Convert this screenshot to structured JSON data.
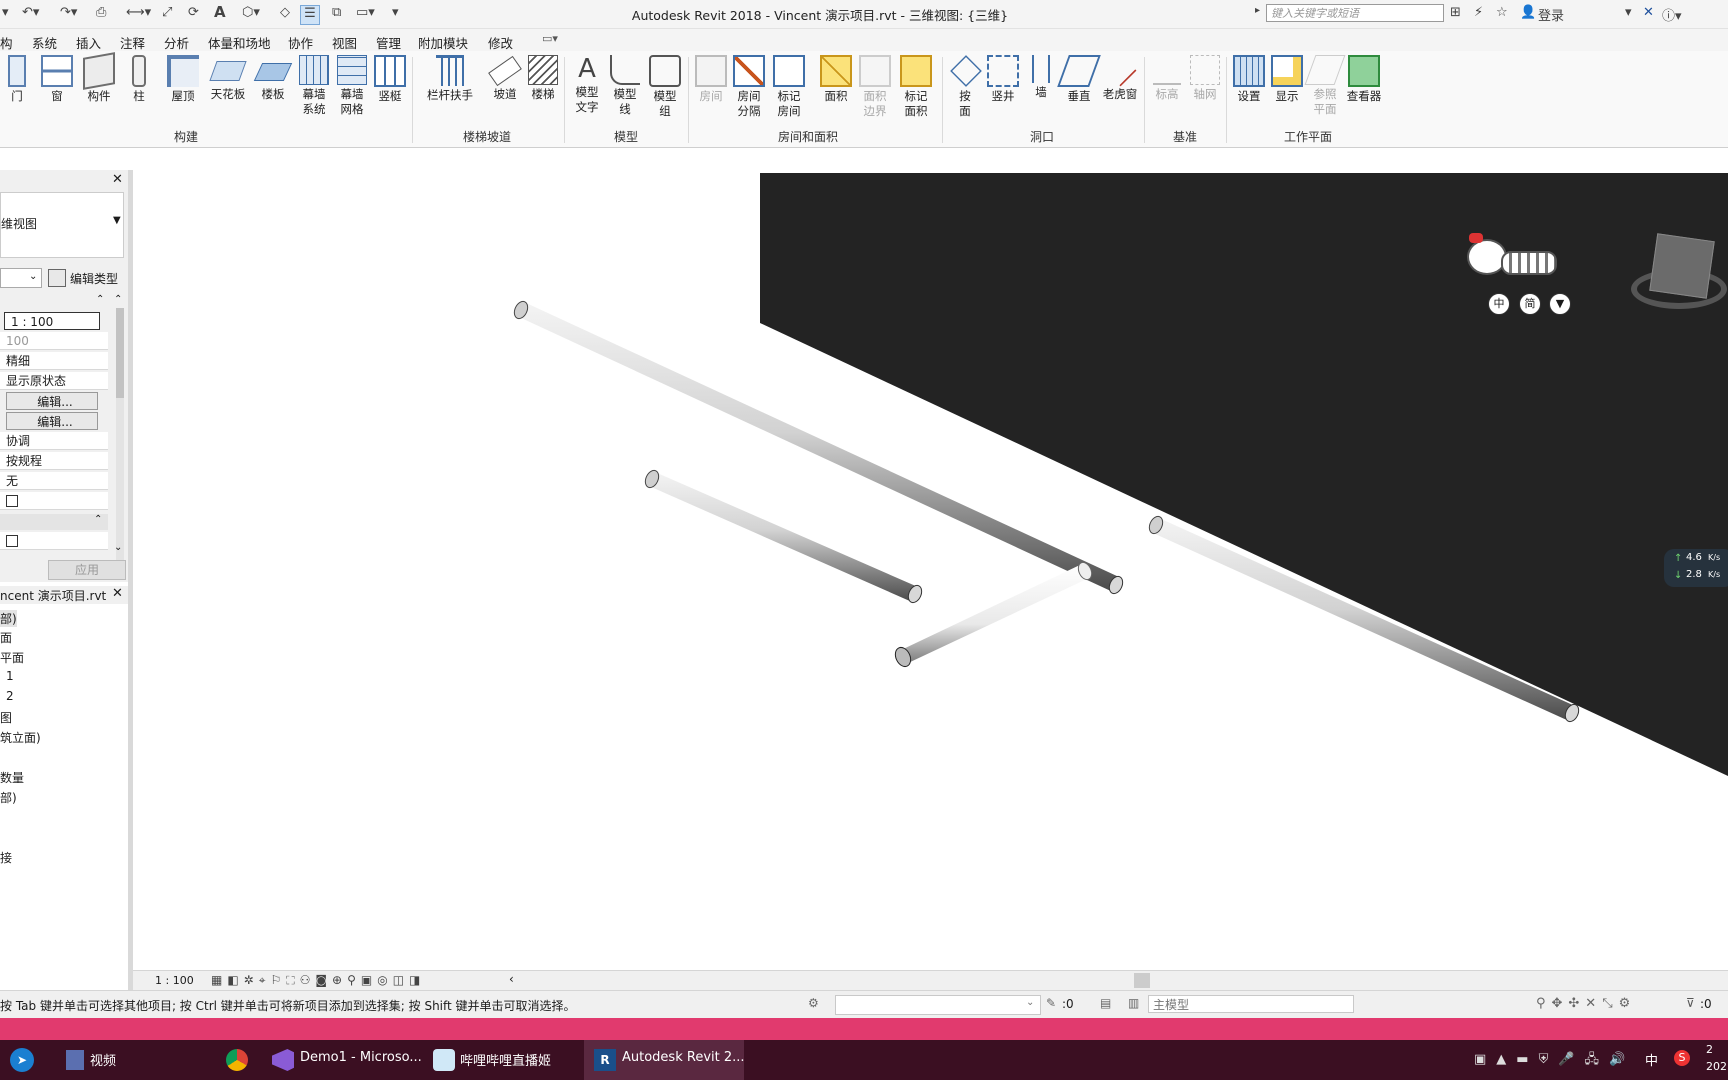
{
  "window": {
    "title": "Autodesk Revit 2018 -     Vincent 演示项目.rvt - 三维视图: {三维}",
    "search_placeholder": "键入关键字或短语",
    "login": "登录"
  },
  "menu_tabs": [
    "构",
    "系统",
    "插入",
    "注释",
    "分析",
    "体量和场地",
    "协作",
    "视图",
    "管理",
    "附加模块",
    "修改"
  ],
  "ribbon": {
    "build": [
      "门",
      "窗",
      "构件",
      "柱",
      "屋顶",
      "天花板",
      "楼板",
      "幕墙\n系统",
      "幕墙\n网格",
      "竖梃"
    ],
    "stairs": [
      "栏杆扶手",
      "坡道",
      "楼梯"
    ],
    "model": [
      "模型\n文字",
      "模型\n线",
      "模型\n组"
    ],
    "room": [
      "房间",
      "房间\n分隔",
      "标记\n房间",
      "面积",
      "面积\n边界",
      "标记\n面积"
    ],
    "opening": [
      "按\n面",
      "竖井",
      "墙",
      "垂直",
      "老虎窗"
    ],
    "datum": [
      "标高",
      "轴网"
    ],
    "workplane": [
      "设置",
      "显示",
      "参照\n平面",
      "查看器"
    ],
    "panels": {
      "build": "构建",
      "stairs": "楼梯坡道",
      "model": "模型",
      "room": "房间和面积",
      "opening": "洞口",
      "datum": "基准",
      "workplane": "工作平面"
    }
  },
  "properties": {
    "type_label": "维视图",
    "edit_type": "编辑类型",
    "rows": [
      "1 : 100",
      "100",
      "精细",
      "显示原状态",
      "编辑...",
      "编辑...",
      "协调",
      "按规程",
      "无"
    ],
    "apply": "应用"
  },
  "browser": {
    "title": "ncent 演示项目.rvt",
    "items": [
      "部)",
      "面",
      "平面",
      "1",
      "2",
      "图",
      "筑立面)",
      "",
      "数量",
      "部)",
      "",
      "",
      "接"
    ]
  },
  "viewbar": {
    "scale": "1 : 100"
  },
  "nav": {
    "labels": [
      "中",
      "简"
    ]
  },
  "network": {
    "up": "4.6",
    "down": "2.8",
    "unit": "K/s"
  },
  "status": {
    "text": "按 Tab 键并单击可选择其他项目; 按 Ctrl 键并单击可将新项目添加到选择集; 按 Shift 键并单击可取消选择。",
    "sel_count": ":0",
    "model_name": "主模型",
    "filter_count": ":0"
  },
  "taskbar": {
    "items": [
      "视频",
      "Demo1 - Microso...",
      "哔哩哔哩直播姬",
      "Autodesk Revit 2..."
    ],
    "tray_lang": "中",
    "clock_top": "2",
    "clock_bottom": "202"
  },
  "colors": {
    "pink": "#e13a6e",
    "taskbar": "#3b0f22",
    "dark_plane": "#232323"
  }
}
